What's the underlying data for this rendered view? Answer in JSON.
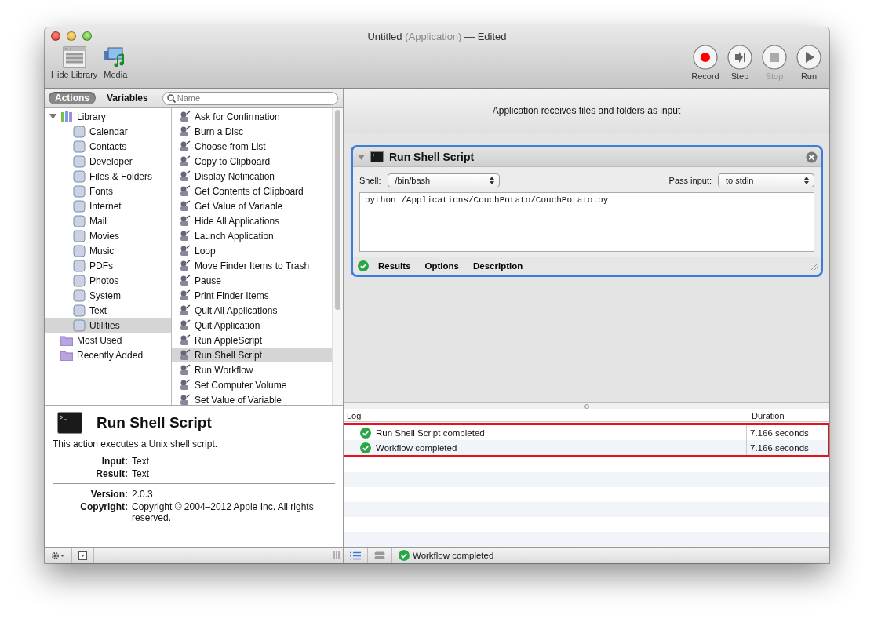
{
  "window": {
    "title": "Untitled",
    "subtitle": "(Application)",
    "suffix": "— Edited"
  },
  "toolbar_left": [
    {
      "kind": "library",
      "label": "Hide Library"
    },
    {
      "kind": "media",
      "label": "Media"
    }
  ],
  "toolbar_right": [
    {
      "kind": "record",
      "label": "Record",
      "disabled": false
    },
    {
      "kind": "step",
      "label": "Step",
      "disabled": false
    },
    {
      "kind": "stop",
      "label": "Stop",
      "disabled": true
    },
    {
      "kind": "run",
      "label": "Run",
      "disabled": false
    }
  ],
  "library_tabs": [
    {
      "label": "Actions",
      "selected": true
    },
    {
      "label": "Variables",
      "selected": false
    }
  ],
  "search": {
    "placeholder": "Name"
  },
  "library": [
    {
      "label": "Library",
      "expanded": true,
      "selected": false,
      "children": [
        {
          "label": "Calendar",
          "selected": false
        },
        {
          "label": "Contacts",
          "selected": false
        },
        {
          "label": "Developer",
          "selected": false
        },
        {
          "label": "Files & Folders",
          "selected": false
        },
        {
          "label": "Fonts",
          "selected": false
        },
        {
          "label": "Internet",
          "selected": false
        },
        {
          "label": "Mail",
          "selected": false
        },
        {
          "label": "Movies",
          "selected": false
        },
        {
          "label": "Music",
          "selected": false
        },
        {
          "label": "PDFs",
          "selected": false
        },
        {
          "label": "Photos",
          "selected": false
        },
        {
          "label": "System",
          "selected": false
        },
        {
          "label": "Text",
          "selected": false
        },
        {
          "label": "Utilities",
          "selected": true
        }
      ]
    },
    {
      "label": "Most Used",
      "selected": false
    },
    {
      "label": "Recently Added",
      "selected": false
    }
  ],
  "actions": [
    {
      "label": "Ask for Confirmation",
      "selected": false
    },
    {
      "label": "Burn a Disc",
      "selected": false
    },
    {
      "label": "Choose from List",
      "selected": false
    },
    {
      "label": "Copy to Clipboard",
      "selected": false
    },
    {
      "label": "Display Notification",
      "selected": false
    },
    {
      "label": "Get Contents of Clipboard",
      "selected": false
    },
    {
      "label": "Get Value of Variable",
      "selected": false
    },
    {
      "label": "Hide All Applications",
      "selected": false
    },
    {
      "label": "Launch Application",
      "selected": false
    },
    {
      "label": "Loop",
      "selected": false
    },
    {
      "label": "Move Finder Items to Trash",
      "selected": false
    },
    {
      "label": "Pause",
      "selected": false
    },
    {
      "label": "Print Finder Items",
      "selected": false
    },
    {
      "label": "Quit All Applications",
      "selected": false
    },
    {
      "label": "Quit Application",
      "selected": false
    },
    {
      "label": "Run AppleScript",
      "selected": false
    },
    {
      "label": "Run Shell Script",
      "selected": true
    },
    {
      "label": "Run Workflow",
      "selected": false
    },
    {
      "label": "Set Computer Volume",
      "selected": false
    },
    {
      "label": "Set Value of Variable",
      "selected": false
    }
  ],
  "description": {
    "title": "Run Shell Script",
    "text": "This action executes a Unix shell script.",
    "fields": [
      {
        "label": "Input:",
        "value": "Text"
      },
      {
        "label": "Result:",
        "value": "Text"
      }
    ],
    "meta": [
      {
        "label": "Version:",
        "value": "2.0.3"
      },
      {
        "label": "Copyright:",
        "value": "Copyright © 2004–2012 Apple Inc.  All rights reserved."
      }
    ]
  },
  "workflow": {
    "input_banner": "Application receives files and folders as input",
    "action": {
      "title": "Run Shell Script",
      "expanded": true,
      "shell_label": "Shell:",
      "shell": "/bin/bash",
      "pass_label": "Pass input:",
      "pass": "to stdin",
      "script": "python /Applications/CouchPotato/CouchPotato.py",
      "tabs": [
        {
          "label": "Results"
        },
        {
          "label": "Options"
        },
        {
          "label": "Description"
        }
      ]
    }
  },
  "log": {
    "columns": [
      "Log",
      "Duration"
    ],
    "highlighted": true,
    "rows": [
      {
        "message": "Run Shell Script completed",
        "duration": "7.166 seconds",
        "succeeded": true
      },
      {
        "message": "Workflow completed",
        "duration": "7.166 seconds",
        "succeeded": true
      }
    ]
  },
  "status_bar": {
    "message": "Workflow completed",
    "succeeded": true
  }
}
